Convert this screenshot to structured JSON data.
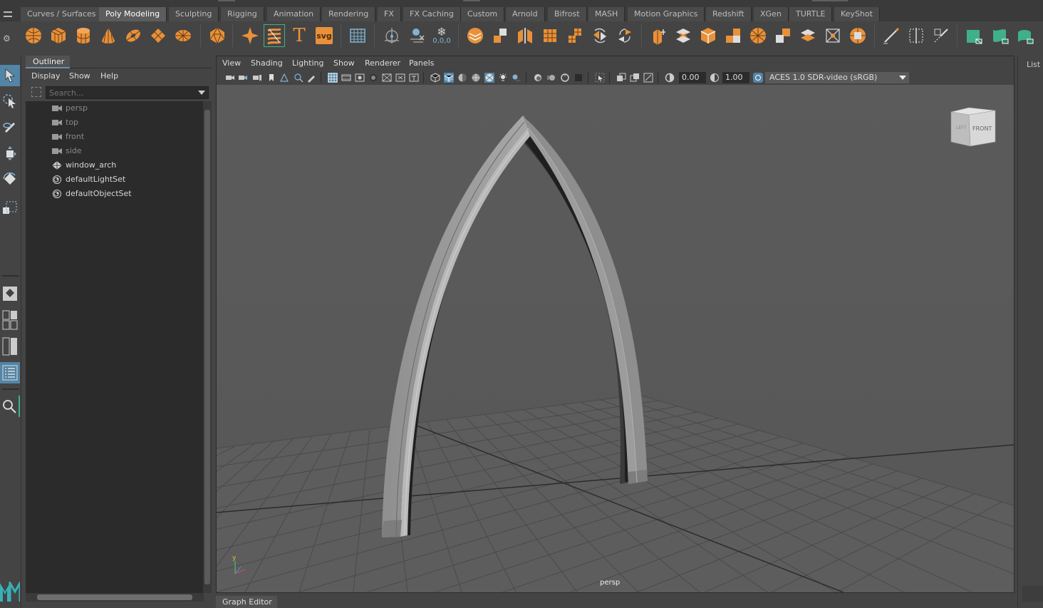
{
  "shelf_tabs": [
    {
      "label": "Curves / Surfaces"
    },
    {
      "label": "Poly Modeling",
      "active": true
    },
    {
      "label": "Sculpting"
    },
    {
      "label": "Rigging"
    },
    {
      "label": "Animation"
    },
    {
      "label": "Rendering"
    },
    {
      "label": "FX"
    },
    {
      "label": "FX Caching"
    },
    {
      "label": "Custom"
    },
    {
      "label": "Arnold"
    },
    {
      "label": "Bifrost"
    },
    {
      "label": "MASH"
    },
    {
      "label": "Motion Graphics"
    },
    {
      "label": "Redshift"
    },
    {
      "label": "XGen"
    },
    {
      "label": "TURTLE"
    },
    {
      "label": "KeyShot"
    }
  ],
  "shelf_icons": {
    "text_tool_glyph": "T",
    "svg_tool_label": "svg",
    "coords_label": "0,0,0"
  },
  "colors": {
    "accent_orange": "#e8913a",
    "accent_teal": "#3fb08a",
    "selection_blue": "#5285a6",
    "viewport_bg": "#5a5a5a"
  },
  "outliner": {
    "tab_label": "Outliner",
    "menu": {
      "display": "Display",
      "show": "Show",
      "help": "Help"
    },
    "search_placeholder": "Search...",
    "items": [
      {
        "label": "persp",
        "type": "camera",
        "dim": true
      },
      {
        "label": "top",
        "type": "camera",
        "dim": true
      },
      {
        "label": "front",
        "type": "camera",
        "dim": true
      },
      {
        "label": "side",
        "type": "camera",
        "dim": true
      },
      {
        "label": "window_arch",
        "type": "mesh",
        "dim": false
      },
      {
        "label": "defaultLightSet",
        "type": "set",
        "dim": false
      },
      {
        "label": "defaultObjectSet",
        "type": "set",
        "dim": false
      }
    ]
  },
  "viewport": {
    "menu": {
      "view": "View",
      "shading": "Shading",
      "lighting": "Lighting",
      "show": "Show",
      "renderer": "Renderer",
      "panels": "Panels"
    },
    "exposure": "0.00",
    "gamma": "1.00",
    "color_space": "ACES 1.0 SDR-video (sRGB)",
    "camera": "persp",
    "viewcube": {
      "left": "LEFT",
      "front": "FRONT"
    },
    "axis_y": "y"
  },
  "right_panel": {
    "list_label": "List"
  },
  "bottom": {
    "graph_editor_tab": "Graph Editor"
  }
}
